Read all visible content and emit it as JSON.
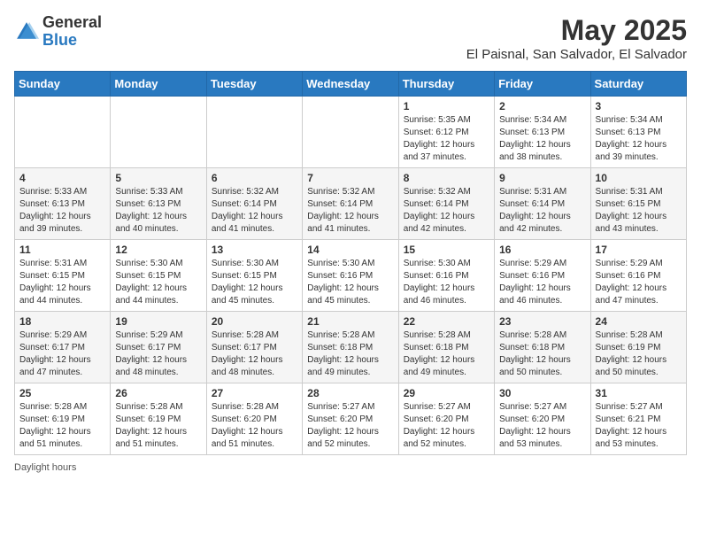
{
  "logo": {
    "general": "General",
    "blue": "Blue"
  },
  "title": {
    "month_year": "May 2025",
    "location": "El Paisnal, San Salvador, El Salvador"
  },
  "days_of_week": [
    "Sunday",
    "Monday",
    "Tuesday",
    "Wednesday",
    "Thursday",
    "Friday",
    "Saturday"
  ],
  "footer": {
    "daylight_label": "Daylight hours"
  },
  "weeks": [
    [
      {
        "day": "",
        "sunrise": "",
        "sunset": "",
        "daylight": ""
      },
      {
        "day": "",
        "sunrise": "",
        "sunset": "",
        "daylight": ""
      },
      {
        "day": "",
        "sunrise": "",
        "sunset": "",
        "daylight": ""
      },
      {
        "day": "",
        "sunrise": "",
        "sunset": "",
        "daylight": ""
      },
      {
        "day": "1",
        "sunrise": "Sunrise: 5:35 AM",
        "sunset": "Sunset: 6:12 PM",
        "daylight": "Daylight: 12 hours and 37 minutes."
      },
      {
        "day": "2",
        "sunrise": "Sunrise: 5:34 AM",
        "sunset": "Sunset: 6:13 PM",
        "daylight": "Daylight: 12 hours and 38 minutes."
      },
      {
        "day": "3",
        "sunrise": "Sunrise: 5:34 AM",
        "sunset": "Sunset: 6:13 PM",
        "daylight": "Daylight: 12 hours and 39 minutes."
      }
    ],
    [
      {
        "day": "4",
        "sunrise": "Sunrise: 5:33 AM",
        "sunset": "Sunset: 6:13 PM",
        "daylight": "Daylight: 12 hours and 39 minutes."
      },
      {
        "day": "5",
        "sunrise": "Sunrise: 5:33 AM",
        "sunset": "Sunset: 6:13 PM",
        "daylight": "Daylight: 12 hours and 40 minutes."
      },
      {
        "day": "6",
        "sunrise": "Sunrise: 5:32 AM",
        "sunset": "Sunset: 6:14 PM",
        "daylight": "Daylight: 12 hours and 41 minutes."
      },
      {
        "day": "7",
        "sunrise": "Sunrise: 5:32 AM",
        "sunset": "Sunset: 6:14 PM",
        "daylight": "Daylight: 12 hours and 41 minutes."
      },
      {
        "day": "8",
        "sunrise": "Sunrise: 5:32 AM",
        "sunset": "Sunset: 6:14 PM",
        "daylight": "Daylight: 12 hours and 42 minutes."
      },
      {
        "day": "9",
        "sunrise": "Sunrise: 5:31 AM",
        "sunset": "Sunset: 6:14 PM",
        "daylight": "Daylight: 12 hours and 42 minutes."
      },
      {
        "day": "10",
        "sunrise": "Sunrise: 5:31 AM",
        "sunset": "Sunset: 6:15 PM",
        "daylight": "Daylight: 12 hours and 43 minutes."
      }
    ],
    [
      {
        "day": "11",
        "sunrise": "Sunrise: 5:31 AM",
        "sunset": "Sunset: 6:15 PM",
        "daylight": "Daylight: 12 hours and 44 minutes."
      },
      {
        "day": "12",
        "sunrise": "Sunrise: 5:30 AM",
        "sunset": "Sunset: 6:15 PM",
        "daylight": "Daylight: 12 hours and 44 minutes."
      },
      {
        "day": "13",
        "sunrise": "Sunrise: 5:30 AM",
        "sunset": "Sunset: 6:15 PM",
        "daylight": "Daylight: 12 hours and 45 minutes."
      },
      {
        "day": "14",
        "sunrise": "Sunrise: 5:30 AM",
        "sunset": "Sunset: 6:16 PM",
        "daylight": "Daylight: 12 hours and 45 minutes."
      },
      {
        "day": "15",
        "sunrise": "Sunrise: 5:30 AM",
        "sunset": "Sunset: 6:16 PM",
        "daylight": "Daylight: 12 hours and 46 minutes."
      },
      {
        "day": "16",
        "sunrise": "Sunrise: 5:29 AM",
        "sunset": "Sunset: 6:16 PM",
        "daylight": "Daylight: 12 hours and 46 minutes."
      },
      {
        "day": "17",
        "sunrise": "Sunrise: 5:29 AM",
        "sunset": "Sunset: 6:16 PM",
        "daylight": "Daylight: 12 hours and 47 minutes."
      }
    ],
    [
      {
        "day": "18",
        "sunrise": "Sunrise: 5:29 AM",
        "sunset": "Sunset: 6:17 PM",
        "daylight": "Daylight: 12 hours and 47 minutes."
      },
      {
        "day": "19",
        "sunrise": "Sunrise: 5:29 AM",
        "sunset": "Sunset: 6:17 PM",
        "daylight": "Daylight: 12 hours and 48 minutes."
      },
      {
        "day": "20",
        "sunrise": "Sunrise: 5:28 AM",
        "sunset": "Sunset: 6:17 PM",
        "daylight": "Daylight: 12 hours and 48 minutes."
      },
      {
        "day": "21",
        "sunrise": "Sunrise: 5:28 AM",
        "sunset": "Sunset: 6:18 PM",
        "daylight": "Daylight: 12 hours and 49 minutes."
      },
      {
        "day": "22",
        "sunrise": "Sunrise: 5:28 AM",
        "sunset": "Sunset: 6:18 PM",
        "daylight": "Daylight: 12 hours and 49 minutes."
      },
      {
        "day": "23",
        "sunrise": "Sunrise: 5:28 AM",
        "sunset": "Sunset: 6:18 PM",
        "daylight": "Daylight: 12 hours and 50 minutes."
      },
      {
        "day": "24",
        "sunrise": "Sunrise: 5:28 AM",
        "sunset": "Sunset: 6:19 PM",
        "daylight": "Daylight: 12 hours and 50 minutes."
      }
    ],
    [
      {
        "day": "25",
        "sunrise": "Sunrise: 5:28 AM",
        "sunset": "Sunset: 6:19 PM",
        "daylight": "Daylight: 12 hours and 51 minutes."
      },
      {
        "day": "26",
        "sunrise": "Sunrise: 5:28 AM",
        "sunset": "Sunset: 6:19 PM",
        "daylight": "Daylight: 12 hours and 51 minutes."
      },
      {
        "day": "27",
        "sunrise": "Sunrise: 5:28 AM",
        "sunset": "Sunset: 6:20 PM",
        "daylight": "Daylight: 12 hours and 51 minutes."
      },
      {
        "day": "28",
        "sunrise": "Sunrise: 5:27 AM",
        "sunset": "Sunset: 6:20 PM",
        "daylight": "Daylight: 12 hours and 52 minutes."
      },
      {
        "day": "29",
        "sunrise": "Sunrise: 5:27 AM",
        "sunset": "Sunset: 6:20 PM",
        "daylight": "Daylight: 12 hours and 52 minutes."
      },
      {
        "day": "30",
        "sunrise": "Sunrise: 5:27 AM",
        "sunset": "Sunset: 6:20 PM",
        "daylight": "Daylight: 12 hours and 53 minutes."
      },
      {
        "day": "31",
        "sunrise": "Sunrise: 5:27 AM",
        "sunset": "Sunset: 6:21 PM",
        "daylight": "Daylight: 12 hours and 53 minutes."
      }
    ]
  ]
}
